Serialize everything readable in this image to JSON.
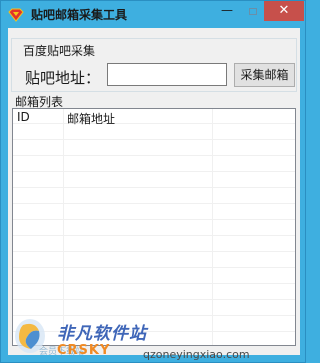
{
  "window": {
    "title": "贴吧邮箱采集工具",
    "minimize": "—",
    "close": "✕"
  },
  "group": {
    "label": "百度贴吧采集",
    "address_label": "贴吧地址：",
    "address_value": "",
    "collect_button": "采集邮箱"
  },
  "list": {
    "label": "邮箱列表",
    "columns": [
      "ID",
      "邮箱地址"
    ]
  },
  "watermark": {
    "cn": "非凡软件站",
    "en": "CRSKY",
    "sub": "会员下载站",
    "url": "qzoneyingxiao.com"
  },
  "colors": {
    "title_bar": "#3eafe0",
    "close_button": "#c7504b",
    "client_bg": "#f0f0f0"
  }
}
